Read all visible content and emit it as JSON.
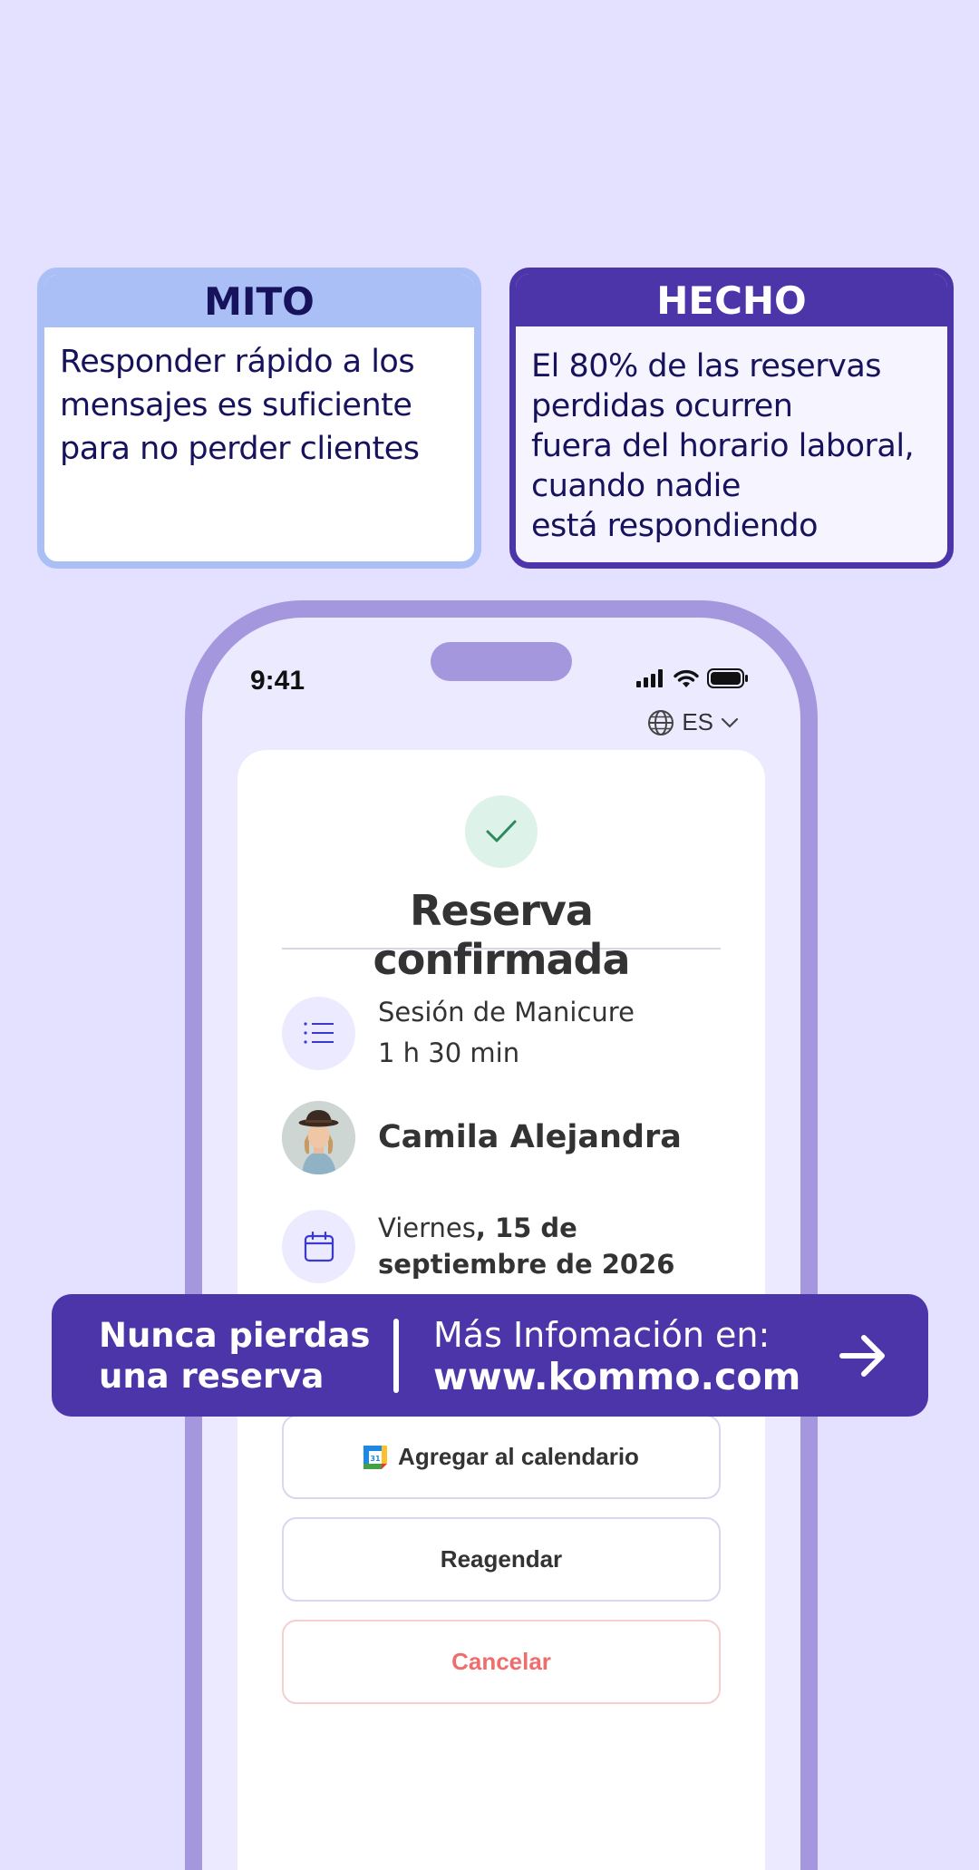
{
  "myth": {
    "heading": "MITO",
    "text": "Responder rápido a los\nmensajes es suficiente\npara no perder clientes"
  },
  "fact": {
    "heading": "HECHO",
    "text": "El 80% de las reservas\nperdidas ocurren\nfuera del horario laboral,\ncuando nadie\nestá respondiendo"
  },
  "phone": {
    "time": "9:41",
    "language": "ES",
    "title": "Reserva confirmada",
    "service": {
      "name": "Sesión de Manicure",
      "duration": "1 h 30 min"
    },
    "client_name": "Camila Alejandra",
    "date": {
      "weekday": "Viernes",
      "date_bold": ", 15 de septiembre de 2026"
    },
    "calendar_icon_day": "31",
    "buttons": {
      "add_calendar": "Agregar al calendario",
      "reschedule": "Reagendar",
      "cancel": "Cancelar"
    }
  },
  "banner": {
    "tagline": "Nunca pierdas\nuna reserva",
    "info_label": "Más Infomación en:",
    "url": "www.kommo.com"
  },
  "colors": {
    "background": "#e4e0ff",
    "brand_purple": "#4b35a8",
    "myth_blue": "#a9bff6",
    "cancel_red": "#ee6e6e"
  }
}
